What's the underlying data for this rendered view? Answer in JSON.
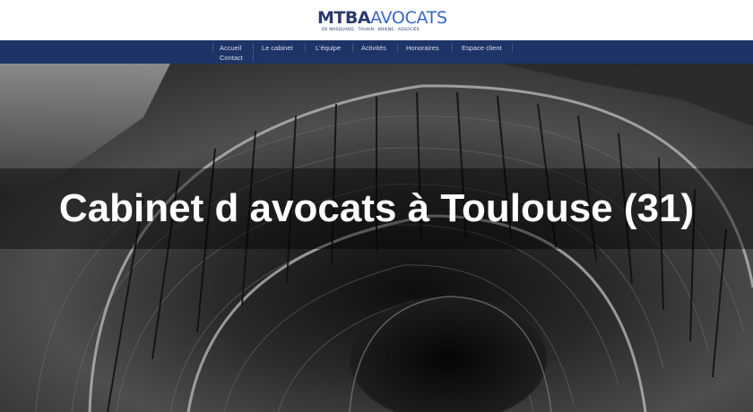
{
  "brand": {
    "name_bold": "MTBA",
    "name_light": "AVOCATS",
    "subtitle": "DE MASQUARD · TAHAIN · BRIENE · ASSOCIÉS",
    "colors": {
      "navy": "#2b3a6e",
      "blue": "#3a66c9"
    }
  },
  "nav": {
    "items": [
      {
        "label": "Accueil"
      },
      {
        "label": "Le cabinet"
      },
      {
        "label": "L'équipe"
      },
      {
        "label": "Activités"
      },
      {
        "label": "Honoraires"
      },
      {
        "label": "Espace client"
      },
      {
        "label": "Contact"
      }
    ],
    "background": "#1f3466"
  },
  "hero": {
    "title": "Cabinet d avocats à Toulouse (31)",
    "image_subject": "spiral-staircase-photo"
  }
}
